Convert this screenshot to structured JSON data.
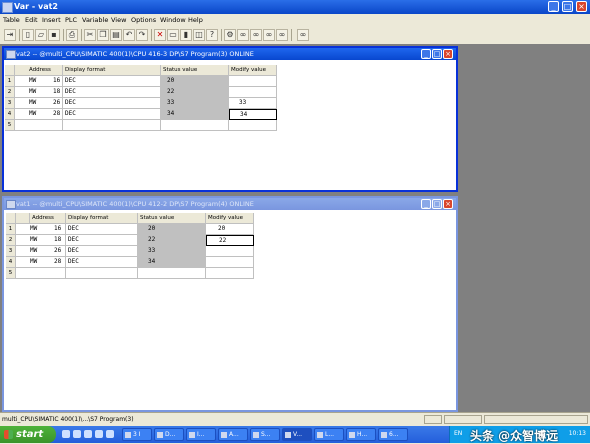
{
  "window": {
    "title": "Var - vat2"
  },
  "menu": [
    "Table",
    "Edit",
    "Insert",
    "PLC",
    "Variable",
    "View",
    "Options",
    "Window",
    "Help"
  ],
  "toolbar_icons": [
    "insert-row-icon",
    "new-icon",
    "open-icon",
    "save-icon",
    "print-icon",
    "cut-icon",
    "copy-icon",
    "paste-icon",
    "undo-icon",
    "redo-icon",
    "delete-icon",
    "monitor-icon",
    "trigger-icon",
    "display-icon",
    "help-icon",
    "online-icon",
    "monitor-variable-icon",
    "modify-variable-icon",
    "update-icon",
    "glasses-icon"
  ],
  "columns": [
    "Address",
    "Display format",
    "Status value",
    "Modify value"
  ],
  "vat2": {
    "title": "vat2 -- @multi_CPU\\SIMATIC 400(1)\\CPU 416-3 DP\\S7 Program(3)  ONLINE",
    "rows": [
      {
        "num": "1",
        "area": "MW",
        "addr": "16",
        "format": "DEC",
        "status": "20",
        "modify": ""
      },
      {
        "num": "2",
        "area": "MW",
        "addr": "18",
        "format": "DEC",
        "status": "22",
        "modify": ""
      },
      {
        "num": "3",
        "area": "MW",
        "addr": "26",
        "format": "DEC",
        "status": "33",
        "modify": "33"
      },
      {
        "num": "4",
        "area": "MW",
        "addr": "28",
        "format": "DEC",
        "status": "34",
        "modify": "34"
      },
      {
        "num": "5",
        "area": "",
        "addr": "",
        "format": "",
        "status": "",
        "modify": ""
      }
    ]
  },
  "vat1": {
    "title": "vat1 -- @multi_CPU\\SIMATIC 400(1)\\CPU 412-2 DP\\S7 Program(4)  ONLINE",
    "rows": [
      {
        "num": "1",
        "area": "MW",
        "addr": "16",
        "format": "DEC",
        "status": "20",
        "modify": "20"
      },
      {
        "num": "2",
        "area": "MW",
        "addr": "18",
        "format": "DEC",
        "status": "22",
        "modify": "22"
      },
      {
        "num": "3",
        "area": "MW",
        "addr": "26",
        "format": "DEC",
        "status": "33",
        "modify": ""
      },
      {
        "num": "4",
        "area": "MW",
        "addr": "28",
        "format": "DEC",
        "status": "34",
        "modify": ""
      },
      {
        "num": "5",
        "area": "",
        "addr": "",
        "format": "",
        "status": "",
        "modify": ""
      }
    ]
  },
  "statusbar": {
    "text": "multi_CPU\\SIMATIC 400(1)\\...\\S7 Program(3)"
  },
  "taskbar": {
    "start": "start",
    "tasks": [
      "3 I",
      "D...",
      "I...",
      "A...",
      "S...",
      "V...",
      "L...",
      "H...",
      "6..."
    ],
    "lang": "EN",
    "clock": "10:13",
    "watermark": "头条 @众智博远"
  }
}
